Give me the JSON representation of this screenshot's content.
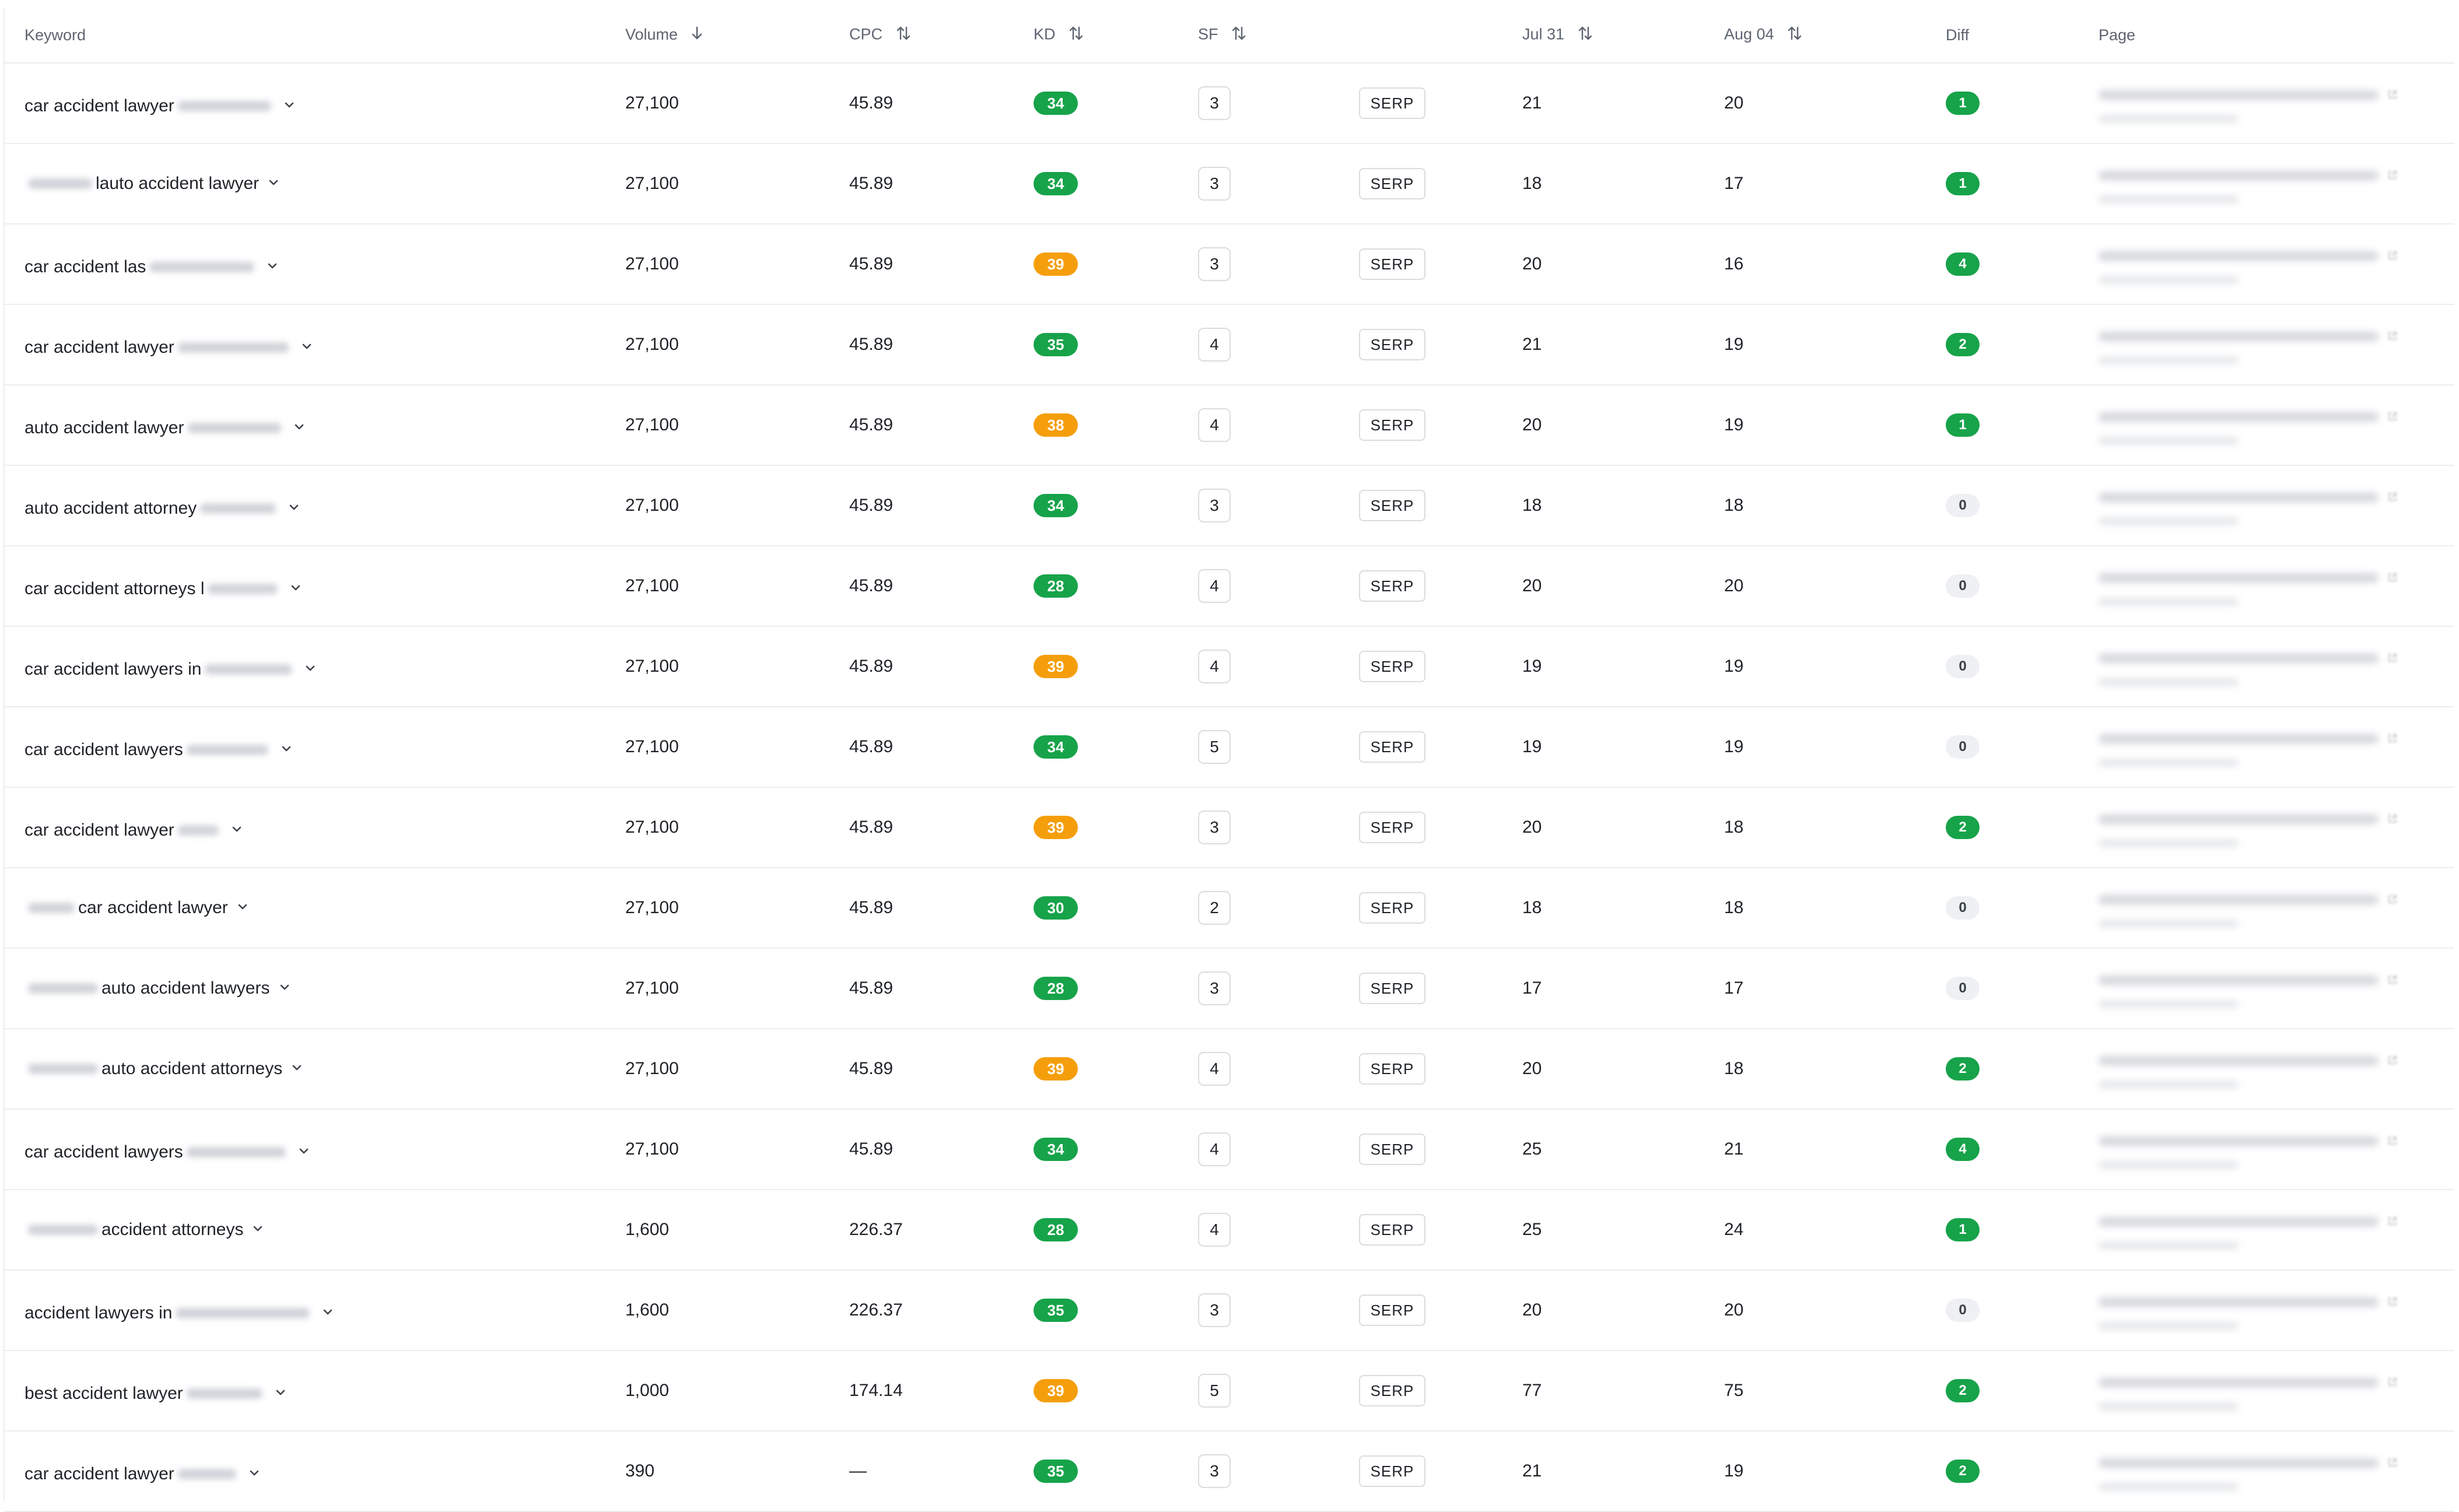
{
  "colors": {
    "kd_green": "#17a34a",
    "kd_orange": "#f59e0b",
    "diff_green": "#17a34a",
    "diff_zero_bg": "#eef0f3"
  },
  "columns": {
    "keyword": "Keyword",
    "volume": "Volume",
    "cpc": "CPC",
    "kd": "KD",
    "sf": "SF",
    "jul": "Jul 31",
    "aug": "Aug 04",
    "diff": "Diff",
    "page": "Page"
  },
  "serp_label": "SERP",
  "rows": [
    {
      "pre": "",
      "text": "car accident lawyer",
      "volume": "27,100",
      "cpc": "45.89",
      "kd": "34",
      "kd_color": "green",
      "sf": "3",
      "jul": "21",
      "aug": "20",
      "diff": "1"
    },
    {
      "pre": "l",
      "text": "auto accident lawyer",
      "volume": "27,100",
      "cpc": "45.89",
      "kd": "34",
      "kd_color": "green",
      "sf": "3",
      "jul": "18",
      "aug": "17",
      "diff": "1"
    },
    {
      "pre": "",
      "text": "car accident las",
      "volume": "27,100",
      "cpc": "45.89",
      "kd": "39",
      "kd_color": "orange",
      "sf": "3",
      "jul": "20",
      "aug": "16",
      "diff": "4"
    },
    {
      "pre": "",
      "text": "car accident lawyer",
      "volume": "27,100",
      "cpc": "45.89",
      "kd": "35",
      "kd_color": "green",
      "sf": "4",
      "jul": "21",
      "aug": "19",
      "diff": "2"
    },
    {
      "pre": "",
      "text": "auto accident lawyer",
      "volume": "27,100",
      "cpc": "45.89",
      "kd": "38",
      "kd_color": "orange",
      "sf": "4",
      "jul": "20",
      "aug": "19",
      "diff": "1"
    },
    {
      "pre": "",
      "text": "auto accident attorney",
      "volume": "27,100",
      "cpc": "45.89",
      "kd": "34",
      "kd_color": "green",
      "sf": "3",
      "jul": "18",
      "aug": "18",
      "diff": "0"
    },
    {
      "pre": "",
      "text": "car accident attorneys l",
      "volume": "27,100",
      "cpc": "45.89",
      "kd": "28",
      "kd_color": "green",
      "sf": "4",
      "jul": "20",
      "aug": "20",
      "diff": "0"
    },
    {
      "pre": "",
      "text": "car accident lawyers in",
      "volume": "27,100",
      "cpc": "45.89",
      "kd": "39",
      "kd_color": "orange",
      "sf": "4",
      "jul": "19",
      "aug": "19",
      "diff": "0"
    },
    {
      "pre": "",
      "text": "car accident lawyers",
      "volume": "27,100",
      "cpc": "45.89",
      "kd": "34",
      "kd_color": "green",
      "sf": "5",
      "jul": "19",
      "aug": "19",
      "diff": "0"
    },
    {
      "pre": "",
      "text": "car accident lawyer",
      "volume": "27,100",
      "cpc": "45.89",
      "kd": "39",
      "kd_color": "orange",
      "sf": "3",
      "jul": "20",
      "aug": "18",
      "diff": "2"
    },
    {
      "pre": "",
      "text": "car accident lawyer",
      "volume": "27,100",
      "cpc": "45.89",
      "kd": "30",
      "kd_color": "green",
      "sf": "2",
      "jul": "18",
      "aug": "18",
      "diff": "0"
    },
    {
      "pre": "",
      "text": "auto accident lawyers",
      "volume": "27,100",
      "cpc": "45.89",
      "kd": "28",
      "kd_color": "green",
      "sf": "3",
      "jul": "17",
      "aug": "17",
      "diff": "0"
    },
    {
      "pre": "",
      "text": "auto accident attorneys",
      "volume": "27,100",
      "cpc": "45.89",
      "kd": "39",
      "kd_color": "orange",
      "sf": "4",
      "jul": "20",
      "aug": "18",
      "diff": "2"
    },
    {
      "pre": "",
      "text": "car accident lawyers",
      "volume": "27,100",
      "cpc": "45.89",
      "kd": "34",
      "kd_color": "green",
      "sf": "4",
      "jul": "25",
      "aug": "21",
      "diff": "4"
    },
    {
      "pre": "",
      "text": "accident attorneys",
      "volume": "1,600",
      "cpc": "226.37",
      "kd": "28",
      "kd_color": "green",
      "sf": "4",
      "jul": "25",
      "aug": "24",
      "diff": "1"
    },
    {
      "pre": "",
      "text": "accident lawyers in",
      "volume": "1,600",
      "cpc": "226.37",
      "kd": "35",
      "kd_color": "green",
      "sf": "3",
      "jul": "20",
      "aug": "20",
      "diff": "0"
    },
    {
      "pre": "",
      "text": "best accident lawyer",
      "volume": "1,000",
      "cpc": "174.14",
      "kd": "39",
      "kd_color": "orange",
      "sf": "5",
      "jul": "77",
      "aug": "75",
      "diff": "2"
    },
    {
      "pre": "",
      "text": "car accident lawyer",
      "volume": "390",
      "cpc": "—",
      "kd": "35",
      "kd_color": "green",
      "sf": "3",
      "jul": "21",
      "aug": "19",
      "diff": "2"
    }
  ]
}
